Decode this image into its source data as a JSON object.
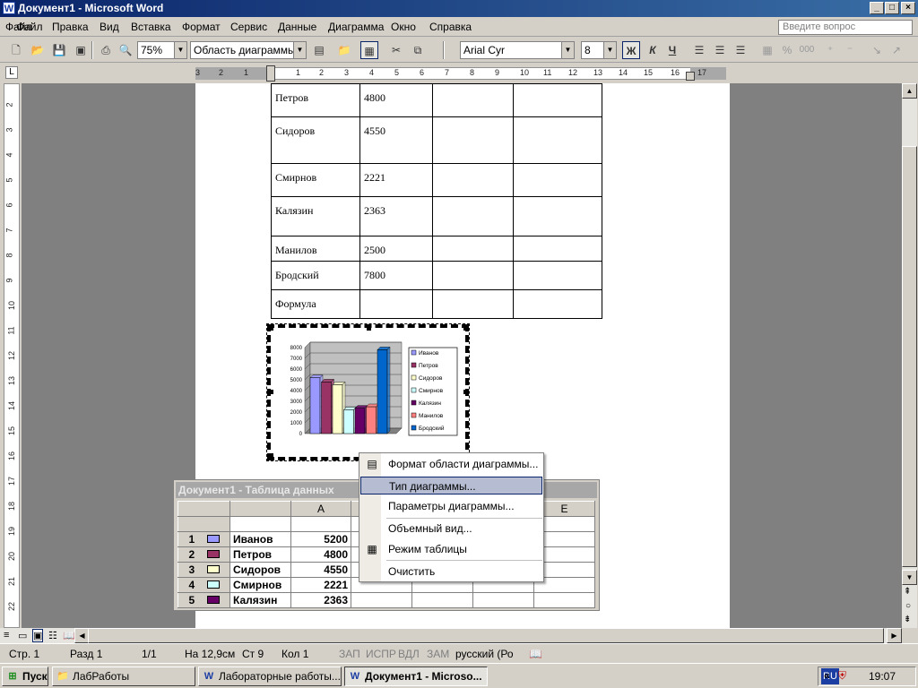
{
  "window": {
    "title": "Документ1 - Microsoft Word",
    "app_icon": "W",
    "controls": {
      "minimize": "_",
      "maximize": "□",
      "close": "×"
    }
  },
  "menu": {
    "items": [
      "Файл",
      "Правка",
      "Вид",
      "Вставка",
      "Формат",
      "Сервис",
      "Данные",
      "Диаграмма",
      "Окно",
      "Справка"
    ],
    "question_placeholder": "Введите вопрос",
    "close_doc": "×"
  },
  "toolbar": {
    "zoom": "75%",
    "object_select": "Область диаграммы",
    "font": "Arial Cyr",
    "size": "8",
    "bold": "Ж",
    "italic": "К",
    "underline": "Ч",
    "percent": "%",
    "thousands": "000"
  },
  "ruler": {
    "h_ticks": [
      "3",
      "2",
      "1",
      "1",
      "2",
      "3",
      "4",
      "5",
      "6",
      "7",
      "8",
      "9",
      "10",
      "11",
      "12",
      "13",
      "14",
      "15",
      "16",
      "17"
    ],
    "v_ticks": [
      "2",
      "3",
      "4",
      "5",
      "6",
      "7",
      "8",
      "9",
      "10",
      "11",
      "12",
      "13",
      "14",
      "15",
      "16",
      "17",
      "18",
      "19",
      "20",
      "21",
      "22"
    ]
  },
  "word_table": {
    "rows": [
      [
        "Петров",
        "4800",
        "",
        ""
      ],
      [
        "Сидоров",
        "4550",
        "",
        ""
      ],
      [
        "Смирнов",
        "2221",
        "",
        ""
      ],
      [
        "Калязин",
        "2363",
        "",
        ""
      ],
      [
        "Манилов",
        "2500",
        "",
        ""
      ],
      [
        "Бродский",
        "7800",
        "",
        ""
      ],
      [
        "Формула",
        "",
        "",
        ""
      ]
    ]
  },
  "chart_data": {
    "type": "bar",
    "categories": [
      ""
    ],
    "series": [
      {
        "name": "Иванов",
        "values": [
          5200
        ],
        "color": "#9999ff"
      },
      {
        "name": "Петров",
        "values": [
          4800
        ],
        "color": "#993366"
      },
      {
        "name": "Сидоров",
        "values": [
          4550
        ],
        "color": "#ffffcc"
      },
      {
        "name": "Смирнов",
        "values": [
          2221
        ],
        "color": "#ccffff"
      },
      {
        "name": "Калязин",
        "values": [
          2363
        ],
        "color": "#660066"
      },
      {
        "name": "Манилов",
        "values": [
          2500
        ],
        "color": "#ff8080"
      },
      {
        "name": "Бродский",
        "values": [
          7800
        ],
        "color": "#0066cc"
      }
    ],
    "y_ticks": [
      "8000",
      "7000",
      "6000",
      "5000",
      "4000",
      "3000",
      "2000",
      "1000",
      "0"
    ],
    "ylim": [
      0,
      8000
    ],
    "grid": true,
    "legend": "right",
    "title": "",
    "xlabel": "",
    "ylabel": ""
  },
  "context_menu": {
    "items": [
      {
        "label": "Формат области диаграммы...",
        "icon": "format-chart-icon"
      },
      {
        "label": "Тип диаграммы...",
        "selected": true
      },
      {
        "label": "Параметры диаграммы..."
      },
      {
        "label": "Объемный вид..."
      },
      {
        "label": "Режим таблицы",
        "icon": "datasheet-icon"
      },
      {
        "label": "Очистить"
      }
    ]
  },
  "datasheet": {
    "title": "Документ1 - Таблица данных",
    "col_headers": [
      "",
      "",
      "A",
      "",
      "",
      "",
      "E"
    ],
    "rows": [
      {
        "num": "1",
        "name": "Иванов",
        "value": "5200",
        "color": "#9999ff"
      },
      {
        "num": "2",
        "name": "Петров",
        "value": "4800",
        "color": "#993366"
      },
      {
        "num": "3",
        "name": "Сидоров",
        "value": "4550",
        "color": "#ffffcc"
      },
      {
        "num": "4",
        "name": "Смирнов",
        "value": "2221",
        "color": "#ccffff"
      },
      {
        "num": "5",
        "name": "Калязин",
        "value": "2363",
        "color": "#660066"
      }
    ]
  },
  "statusbar": {
    "page": "Стр. 1",
    "section": "Разд 1",
    "pages": "1/1",
    "at": "На 12,9см",
    "line": "Ст 9",
    "col": "Кол 1",
    "rec": "ЗАП",
    "trk": "ИСПР",
    "ext": "ВДЛ",
    "ovr": "ЗАМ",
    "lang": "русский (Ро"
  },
  "taskbar": {
    "start": "Пуск",
    "buttons": [
      {
        "label": "ЛабРаботы",
        "active": false
      },
      {
        "label": "Лабораторные работы...",
        "active": false
      },
      {
        "label": "Документ1 - Microso...",
        "active": true
      }
    ],
    "lang": "RU",
    "time": "19:07"
  }
}
